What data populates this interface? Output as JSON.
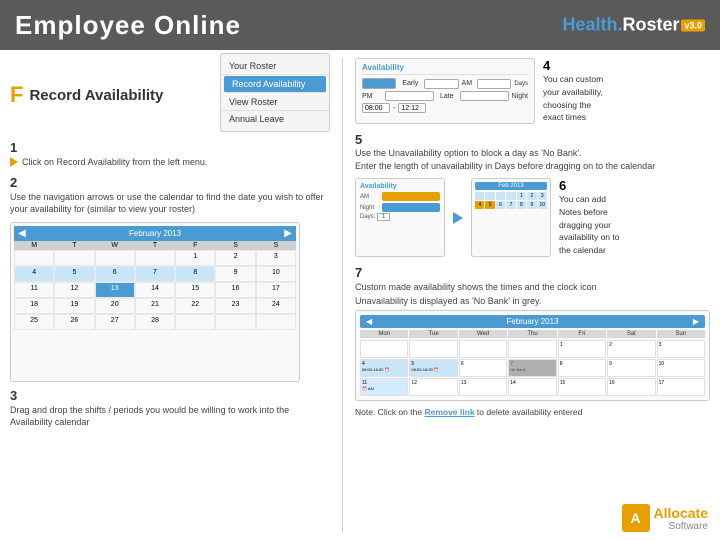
{
  "header": {
    "title": "Employee Online",
    "logo_health": "Health.",
    "logo_roster": "Roster",
    "logo_badge": "v3.0"
  },
  "section": {
    "letter": "F",
    "title": "Record Availability"
  },
  "steps": {
    "step1": {
      "num": "1",
      "text": "Click on Record Availability from the left menu."
    },
    "step2": {
      "num": "2",
      "text": "Use the navigation arrows or use the calendar to find the date you wish to offer your availability for (similar to view your roster)"
    },
    "step3": {
      "num": "3",
      "text": "Drag and drop the shifts / periods you would be willing to work into the Availability calendar"
    },
    "step4": {
      "num": "4",
      "desc1": "You can custom",
      "desc2": "your availability,",
      "desc3": "choosing the",
      "desc4": "exact times"
    },
    "step5": {
      "num": "5",
      "text1": "Use the Unavailability option to block a day as 'No Bank'.",
      "text2": "Enter the length of unavailability in Days before dragging on to the calendar"
    },
    "step6": {
      "num": "6",
      "desc1": "You can add",
      "desc2": "Notes before",
      "desc3": "dragging your",
      "desc4": "availability on to",
      "desc5": "the calendar"
    },
    "step7": {
      "num": "7",
      "text1": "Custom made availability shows the times and the clock icon",
      "text2": "Unavailability is displayed as 'No Bank' in grey."
    }
  },
  "menu": {
    "items": [
      {
        "label": "Your Roster",
        "active": false
      },
      {
        "label": "Record Availability",
        "active": true
      },
      {
        "label": "View Roster",
        "active": false
      },
      {
        "label": "Annual Leave",
        "active": false
      }
    ]
  },
  "avail_form": {
    "title": "Availability",
    "rows": [
      {
        "label": "All Day",
        "sub1": "Early",
        "sub2": "AM"
      },
      {
        "label": "PM",
        "sub1": "Late",
        "sub2": "Night"
      }
    ],
    "time_from": "08:00",
    "time_to": "12:12",
    "days_label": "Days"
  },
  "calendar": {
    "month_label": "February 2013",
    "days": [
      "Mon",
      "Tue",
      "Wed",
      "Thu",
      "Fri",
      "Sat",
      "Sun"
    ],
    "weeks": [
      [
        "",
        "",
        "",
        "",
        "1",
        "2",
        "3"
      ],
      [
        "4",
        "5",
        "6",
        "7",
        "8",
        "9",
        "10"
      ],
      [
        "11",
        "12",
        "13",
        "14",
        "15",
        "16",
        "17"
      ],
      [
        "18",
        "19",
        "20",
        "21",
        "22",
        "23",
        "24"
      ],
      [
        "25",
        "26",
        "27",
        "28",
        "",
        "",
        ""
      ]
    ]
  },
  "note": {
    "prefix": "Note:  Click on the",
    "link": "Remove link",
    "suffix": "to delete availability entered"
  },
  "allocate": {
    "line1": "Allocate",
    "line2": "Software"
  }
}
